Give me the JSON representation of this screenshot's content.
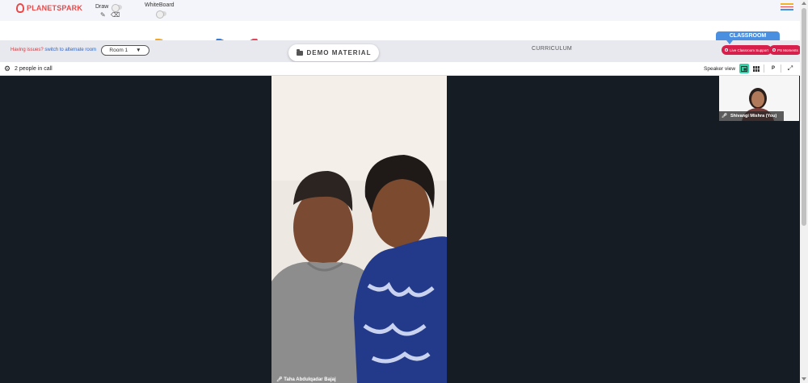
{
  "app": {
    "logo_text": "PLANETSPARK"
  },
  "toolbar": {
    "draw_label": "Draw",
    "whiteboard_label": "WhiteBoard",
    "icons": [
      "pencil-icon",
      "eraser-icon",
      "hamburger-menu-icon"
    ]
  },
  "room_bar": {
    "issue_text": "Having issues?",
    "switch_text": "switch to alternate room",
    "room_selected": "Room 1",
    "demo_material": "DEMO MATERIAL",
    "curriculum": "CURRICULUM",
    "classroom_tab": "CLASSROOM",
    "support_pill": "Live Classroom Support",
    "moments_pill": "PS Moments"
  },
  "call": {
    "people_count": "2 people in call",
    "view_label": "Speaker view",
    "p_button": "P"
  },
  "participants": {
    "main_name": "Taha Abdulqadar Bajaj",
    "self_name": "Shivangi Mishra (You)"
  },
  "colors": {
    "brand_red": "#e84a4a",
    "accent_blue": "#4a8fe0",
    "pill_red": "#d61f4a",
    "stage_bg": "#151c23",
    "active_view": "#2ed3a6"
  }
}
